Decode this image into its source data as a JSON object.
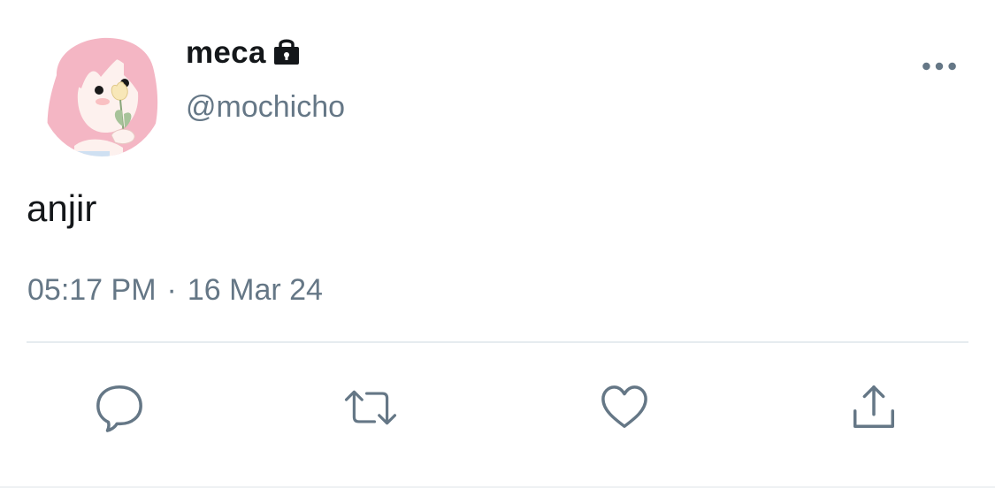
{
  "user": {
    "display_name": "meca",
    "handle": "@mochicho",
    "protected_icon": "lock-icon",
    "avatar": "profile-avatar"
  },
  "tweet": {
    "text": "anjir",
    "time": "05:17 PM",
    "separator": "·",
    "date": "16 Mar 24"
  },
  "actions": {
    "reply_icon": "reply-icon",
    "retweet_icon": "retweet-icon",
    "like_icon": "heart-icon",
    "share_icon": "share-icon",
    "more_icon": "more-dots-icon"
  },
  "colors": {
    "text": "#14171a",
    "secondary": "#657786",
    "divider": "#e6ecf0",
    "icon": "#657786"
  }
}
